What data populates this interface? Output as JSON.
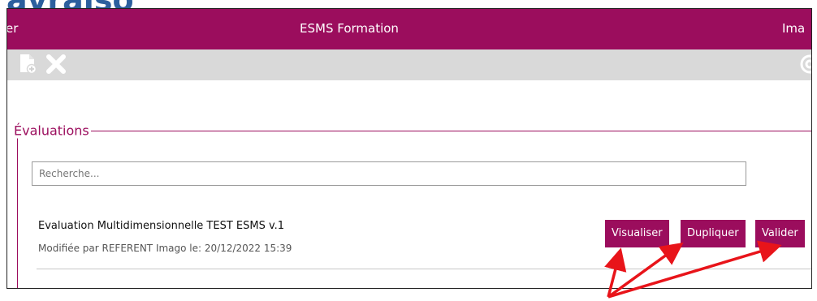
{
  "logo": {
    "text": "avraiso"
  },
  "header": {
    "left_text": "er",
    "title": "ESMS Formation",
    "right_text": "Ima"
  },
  "toolbar": {
    "icons": [
      "new-document-icon",
      "delete-icon",
      "at-icon"
    ]
  },
  "section": {
    "legend": "Évaluations",
    "search": {
      "placeholder": "Recherche...",
      "value": ""
    }
  },
  "evaluation": {
    "title": "Evaluation Multidimensionnelle TEST ESMS v.1",
    "meta": "Modifiée par REFERENT Imago le: 20/12/2022 15:39",
    "buttons": {
      "view": "Visualiser",
      "duplicate": "Dupliquer",
      "validate": "Valider"
    }
  },
  "colors": {
    "accent": "#9b0d5d",
    "toolbar": "#d9d9d9",
    "annotation": "#e8141a"
  }
}
